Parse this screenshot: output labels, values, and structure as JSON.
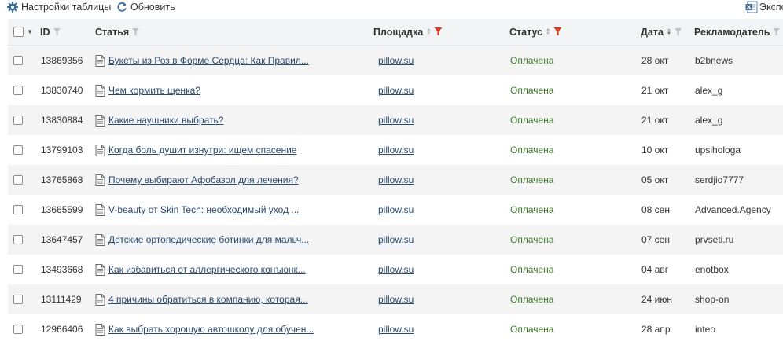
{
  "toolbar": {
    "settings_label": "Настройки таблицы",
    "refresh_label": "Обновить",
    "export_label": "Экспо"
  },
  "columns": {
    "id": "ID",
    "article": "Статья",
    "site": "Площадка",
    "status": "Статус",
    "date": "Дата",
    "advertiser": "Рекламодатель"
  },
  "rows": [
    {
      "id": "13869356",
      "article": "Букеты из Роз в Форме Сердца: Как Правил...",
      "site": "pillow.su",
      "status": "Оплачена",
      "date": "28 окт",
      "advertiser": "b2bnews"
    },
    {
      "id": "13830740",
      "article": "Чем кормить щенка?",
      "site": "pillow.su",
      "status": "Оплачена",
      "date": "21 окт",
      "advertiser": "alex_g"
    },
    {
      "id": "13830884",
      "article": "Какие наушники выбрать?",
      "site": "pillow.su",
      "status": "Оплачена",
      "date": "21 окт",
      "advertiser": "alex_g"
    },
    {
      "id": "13799103",
      "article": "Когда боль душит изнутри: ищем спасение",
      "site": "pillow.su",
      "status": "Оплачена",
      "date": "10 окт",
      "advertiser": "upsihologa"
    },
    {
      "id": "13765868",
      "article": "Почему выбирают Афобазол для лечения?",
      "site": "pillow.su",
      "status": "Оплачена",
      "date": "05 окт",
      "advertiser": "serdjio7777"
    },
    {
      "id": "13665599",
      "article": "V-beauty от Skin Tech: необходимый уход ...",
      "site": "pillow.su",
      "status": "Оплачена",
      "date": "08 сен",
      "advertiser": "Advanced.Agency"
    },
    {
      "id": "13647457",
      "article": "Детские ортопедические ботинки для мальч...",
      "site": "pillow.su",
      "status": "Оплачена",
      "date": "07 сен",
      "advertiser": "prvseti.ru"
    },
    {
      "id": "13493668",
      "article": "Как избавиться от аллергического конъюнк...",
      "site": "pillow.su",
      "status": "Оплачена",
      "date": "04 авг",
      "advertiser": "enotbox"
    },
    {
      "id": "13111429",
      "article": "4 причины обратиться в компанию, которая...",
      "site": "pillow.su",
      "status": "Оплачена",
      "date": "24 июн",
      "advertiser": "shop-on"
    },
    {
      "id": "12966406",
      "article": "Как выбрать хорошую автошколу для обучен...",
      "site": "pillow.su",
      "status": "Оплачена",
      "date": "28 апр",
      "advertiser": "inteo"
    }
  ],
  "colors": {
    "link": "#2a4a6e",
    "status_paid": "#3f7d2c",
    "active_filter": "#e03a1e",
    "header_bg": "#f3f4f6",
    "alt_row_bg": "#f4f4f4"
  },
  "icons": {
    "settings": "gear-icon",
    "refresh": "refresh-icon",
    "export": "excel-icon",
    "article": "document-icon",
    "filter": "funnel-icon",
    "sort": "sort-arrows-icon"
  }
}
